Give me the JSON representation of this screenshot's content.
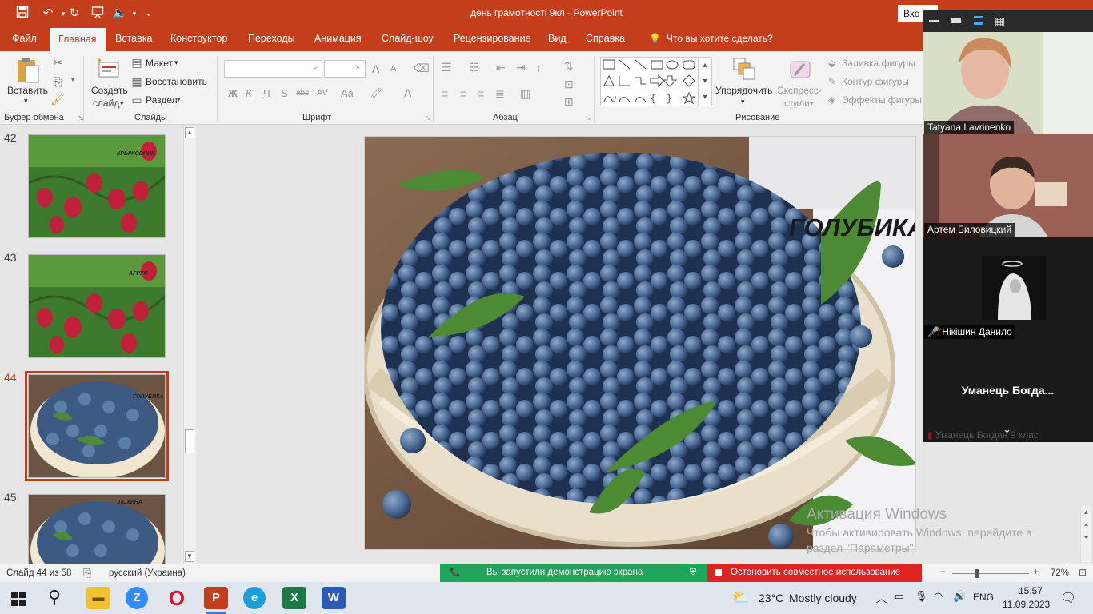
{
  "titlebar": {
    "document_title": "день грамотності 9кл  -  PowerPoint",
    "signin_label": "Вхо"
  },
  "tabs": [
    {
      "label": "Файл"
    },
    {
      "label": "Главная"
    },
    {
      "label": "Вставка"
    },
    {
      "label": "Конструктор"
    },
    {
      "label": "Переходы"
    },
    {
      "label": "Анимация"
    },
    {
      "label": "Слайд-шоу"
    },
    {
      "label": "Рецензирование"
    },
    {
      "label": "Вид"
    },
    {
      "label": "Справка"
    },
    {
      "label": "Что вы хотите сделать?"
    }
  ],
  "ribbon": {
    "paste_label": "Вставить",
    "clipboard_group": "Буфер обмена",
    "new_slide_label_1": "Создать",
    "new_slide_label_2": "слайд",
    "layout_label": "Макет",
    "reset_label": "Восстановить",
    "section_label": "Раздел",
    "slides_group": "Слайды",
    "font_group": "Шрифт",
    "bold": "Ж",
    "italic": "К",
    "underline": "Ч",
    "shadow": "S",
    "strike": "abc",
    "charspace": "AV",
    "case": "Aa",
    "grow": "A",
    "shrink": "A",
    "paragraph_group": "Абзац",
    "arrange_label": "Упорядочить",
    "quick_styles_1": "Экспресс-",
    "quick_styles_2": "стили",
    "shape_fill": "Заливка фигуры",
    "shape_outline": "Контур фигуры",
    "shape_effects": "Эффекты фигуры",
    "drawing_group": "Рисование"
  },
  "slides": [
    {
      "number": "42",
      "label": "КРЫЖОВНИК"
    },
    {
      "number": "43",
      "label": "АГРУС"
    },
    {
      "number": "44",
      "label": "ГОЛУБИКА"
    },
    {
      "number": "45",
      "label": "ЛОХИНА"
    }
  ],
  "current_slide": {
    "title": "ГОЛУБИКА"
  },
  "watermark": {
    "line1": "Активация Windows",
    "line2": "Чтобы активировать Windows, перейдите в раздел \"Параметры\"."
  },
  "statusbar": {
    "slide_counter": "Слайд 44 из 58",
    "language": "русский (Украина)",
    "zoom": "72%"
  },
  "share": {
    "message": "Вы запустили демонстрацию экрана",
    "stop_label": "Остановить совместное использование"
  },
  "zoom_participants": [
    {
      "name": "Tatyana Lavrinenko"
    },
    {
      "name": "Артем Биловицкий"
    },
    {
      "name": "Нікішин Данило"
    },
    {
      "name": "Уманець  Богда..."
    },
    {
      "name": "Уманець Богдан 9 клас"
    }
  ],
  "taskbar": {
    "weather_temp": "23°C",
    "weather_text": "Mostly cloudy",
    "lang": "ENG",
    "time": "15:57",
    "date": "11.09.2023"
  },
  "colors": {
    "ppt_accent": "#c43e1c",
    "share_green": "#1fa65a",
    "share_red": "#e02323"
  }
}
